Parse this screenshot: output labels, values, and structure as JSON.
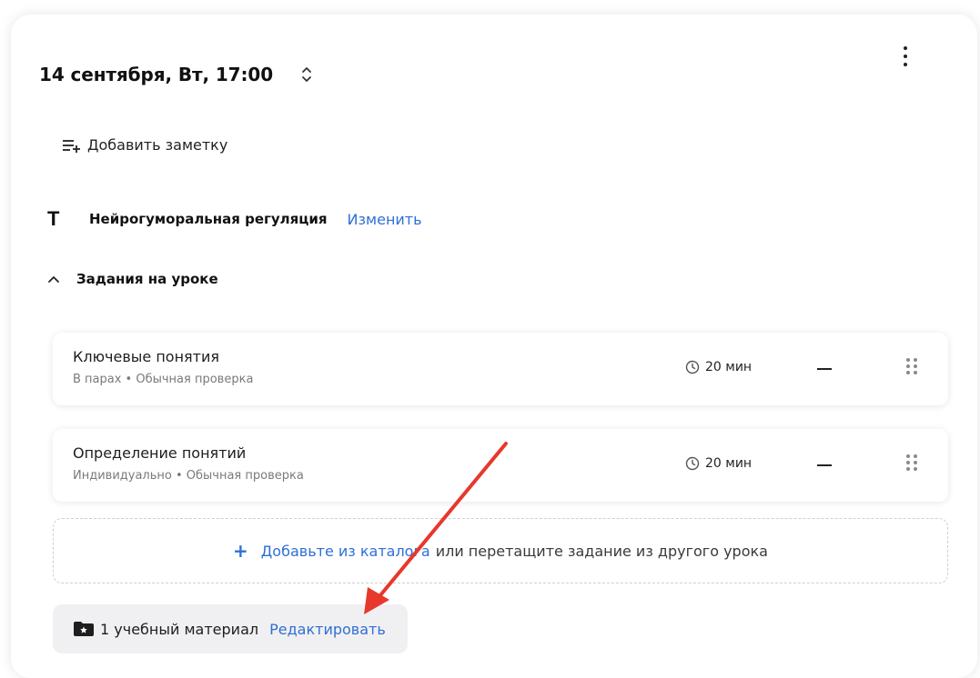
{
  "header": {
    "date": "14 сентября, Вт, 17:00"
  },
  "note": {
    "label": "Добавить заметку"
  },
  "topic": {
    "icon_letter": "T",
    "title": "Нейрогуморальная регуляция",
    "edit_label": "Изменить"
  },
  "section": {
    "title": "Задания на уроке",
    "tasks": [
      {
        "title": "Ключевые понятия",
        "subtitle": "В парах • Обычная проверка",
        "time": "20 мин"
      },
      {
        "title": "Определение понятий",
        "subtitle": "Индивидуально • Обычная проверка",
        "time": "20 мин"
      }
    ]
  },
  "dropzone": {
    "plus": "+",
    "link_label": "Добавьте из каталога",
    "rest_text": "или перетащите задание из другого урока"
  },
  "materials": {
    "label": "1 учебный материал",
    "edit_label": "Редактировать"
  },
  "colors": {
    "accent": "#2f6fd6",
    "annotation_arrow": "#e8372c"
  },
  "icons": {
    "sort": "sort-updown-icon",
    "more": "more-vertical-icon",
    "note": "add-note-icon",
    "topic": "text-t-icon",
    "collapse": "chevron-up-icon",
    "clock": "clock-icon",
    "drag": "drag-handle-icon",
    "folder": "folder-star-icon"
  }
}
